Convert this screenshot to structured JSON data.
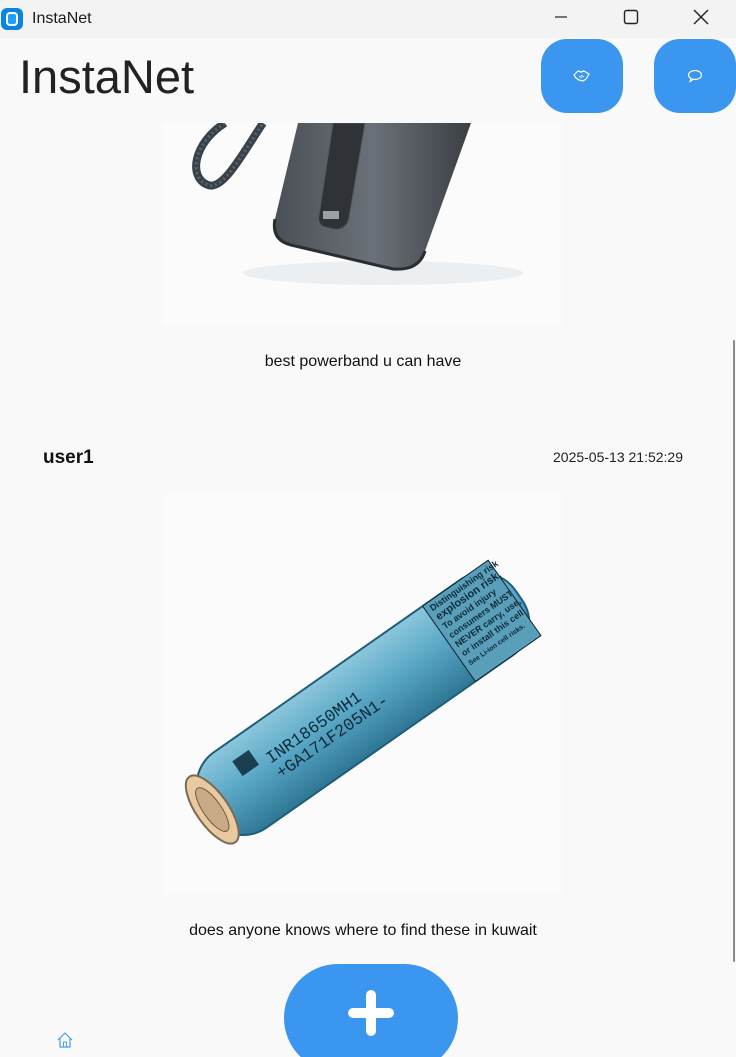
{
  "window": {
    "title": "InstaNet"
  },
  "header": {
    "title": "InstaNet"
  },
  "posts": [
    {
      "caption": "best powerband u can have"
    },
    {
      "user": "user1",
      "timestamp": "2025-05-13 21:52:29",
      "caption": "does anyone knows where to find these in kuwait"
    }
  ],
  "battery_labels": {
    "warning": [
      "Distinguishing risk",
      "explosion risk.",
      "To avoid injury",
      "consumers MUST",
      "NEVER carry, use,",
      "or install this cell",
      "See Li-ion cell risks."
    ],
    "model": [
      "INR18650MH1",
      "+GA171F205N1-"
    ]
  },
  "icons": {
    "app": "app-icon",
    "header_left": "handshake-icon",
    "header_right": "chat-bubble-icon",
    "add": "plus-icon",
    "nav": "home-icon"
  },
  "colors": {
    "accent": "#3a96ef",
    "background": "#f9f9f9",
    "titlebar": "#f3f3f3"
  }
}
